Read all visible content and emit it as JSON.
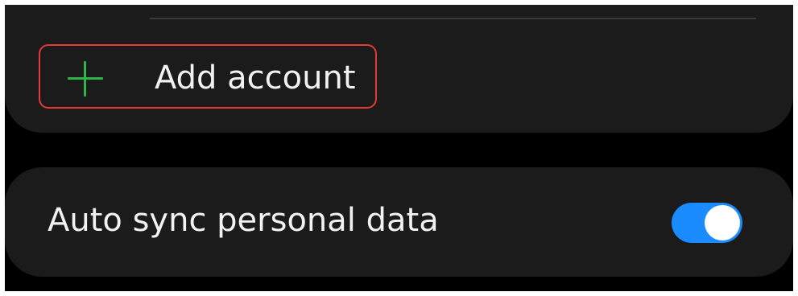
{
  "accounts": {
    "add_account_label": "Add account",
    "add_icon": "plus-icon",
    "accent_color": "#2fb34a",
    "highlight_color": "#e53935"
  },
  "sync": {
    "label": "Auto sync personal data",
    "enabled": true,
    "toggle_color": "#1a8cff"
  }
}
